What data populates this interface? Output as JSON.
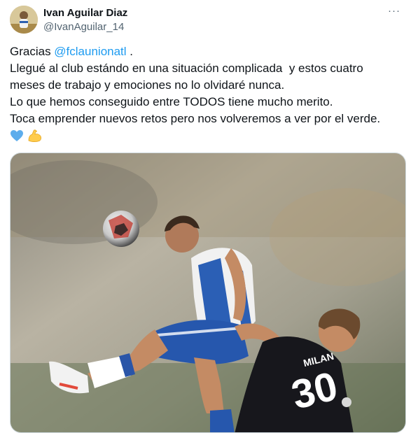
{
  "author": {
    "display_name": "Ivan Aguilar Diaz",
    "handle": "@IvanAguilar_14"
  },
  "more_menu": {
    "icon": "more-horizontal-icon",
    "label": "···"
  },
  "tweet": {
    "line1_prefix": "Gracias ",
    "mention": "@fclaunionatl",
    "line1_suffix": " .",
    "line2": "Llegué al club estándo en una situación complicada  y estos cuatro",
    "line3": "meses de trabajo y emociones no lo olvidaré nunca.",
    "line4": "Lo que hemos conseguido entre TODOS tiene mucho merito.",
    "line5": "Toca emprender nuevos retos pero nos volveremos a ver por el verde.",
    "emojis": [
      "blue-heart-icon",
      "flexed-biceps-icon"
    ]
  },
  "media": {
    "kind": "photo",
    "jersey_name": "MILAN",
    "jersey_number": "30"
  },
  "colors": {
    "link": "#1d9bf0",
    "text": "#0f1419",
    "secondary": "#536471",
    "border": "#cfd9de"
  }
}
